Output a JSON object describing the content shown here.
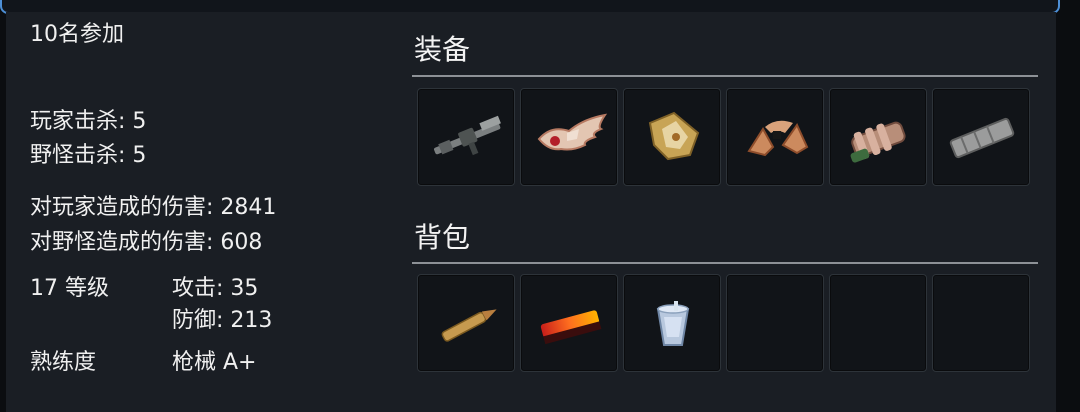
{
  "participants": "10名参加",
  "stats": {
    "player_kills": "玩家击杀: 5",
    "monster_kills": "野怪击杀: 5",
    "damage_to_players": "对玩家造成的伤害: 2841",
    "damage_to_monsters": "对野怪造成的伤害: 608",
    "level": "17 等级",
    "attack": "攻击: 35",
    "defense": "防御: 213",
    "proficiency_label": "熟练度",
    "proficiency_value": "枪械 A+"
  },
  "equipment": {
    "title": "装备",
    "slots": [
      {
        "icon": "rifle-icon"
      },
      {
        "icon": "winged-crown-icon"
      },
      {
        "icon": "shield-icon"
      },
      {
        "icon": "shoulder-armor-icon"
      },
      {
        "icon": "gauntlet-icon"
      },
      {
        "icon": "magazine-icon"
      }
    ]
  },
  "backpack": {
    "title": "背包",
    "slots": [
      {
        "icon": "bullet-icon"
      },
      {
        "icon": "ammo-bar-icon"
      },
      {
        "icon": "cup-icon"
      },
      {
        "icon": ""
      },
      {
        "icon": ""
      },
      {
        "icon": ""
      }
    ]
  },
  "colors": {
    "accent_border": "#4d8fd6",
    "panel_bg": "#1a1e24",
    "slot_bg": "#111418"
  }
}
